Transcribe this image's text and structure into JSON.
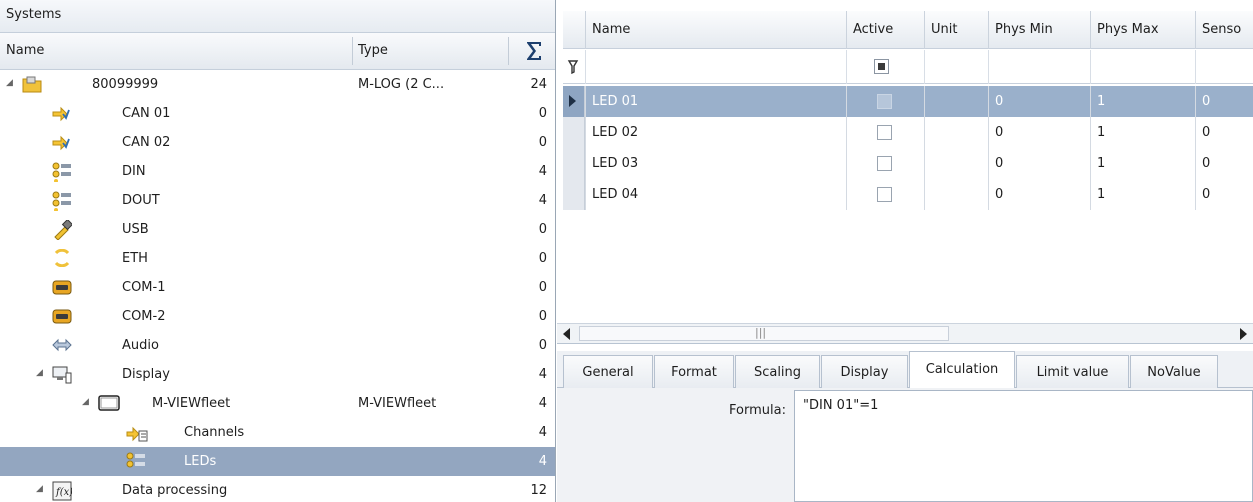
{
  "systems_panel": {
    "title": "Systems",
    "columns": {
      "name": "Name",
      "type": "Type",
      "sum_icon": "sigma-icon"
    },
    "tree": [
      {
        "label": "80099999",
        "type": "M-LOG (2 C...",
        "count": "24",
        "level": 0,
        "icon": "folder-device-icon"
      },
      {
        "label": "CAN 01",
        "type": "",
        "count": "0",
        "level": 1,
        "icon": "can-icon"
      },
      {
        "label": "CAN 02",
        "type": "",
        "count": "0",
        "level": 1,
        "icon": "can-icon"
      },
      {
        "label": "DIN",
        "type": "",
        "count": "4",
        "level": 1,
        "icon": "digital-io-icon"
      },
      {
        "label": "DOUT",
        "type": "",
        "count": "4",
        "level": 1,
        "icon": "digital-io-icon"
      },
      {
        "label": "USB",
        "type": "",
        "count": "0",
        "level": 1,
        "icon": "usb-icon"
      },
      {
        "label": "ETH",
        "type": "",
        "count": "0",
        "level": 1,
        "icon": "ethernet-icon"
      },
      {
        "label": "COM-1",
        "type": "",
        "count": "0",
        "level": 1,
        "icon": "serial-port-icon"
      },
      {
        "label": "COM-2",
        "type": "",
        "count": "0",
        "level": 1,
        "icon": "serial-port-icon"
      },
      {
        "label": "Audio",
        "type": "",
        "count": "0",
        "level": 1,
        "icon": "audio-icon"
      },
      {
        "label": "Display",
        "type": "",
        "count": "4",
        "level": 1,
        "icon": "display-icon"
      },
      {
        "label": "M-VIEWfleet",
        "type": "M-VIEWfleet",
        "count": "4",
        "level": 2,
        "icon": "monitor-icon"
      },
      {
        "label": "Channels",
        "type": "",
        "count": "4",
        "level": 3,
        "icon": "channels-icon"
      },
      {
        "label": "LEDs",
        "type": "",
        "count": "4",
        "level": 3,
        "icon": "leds-icon",
        "selected": true
      },
      {
        "label": "Data processing",
        "type": "",
        "count": "12",
        "level": 1,
        "icon": "function-icon"
      }
    ]
  },
  "grid": {
    "columns": [
      "Name",
      "Active",
      "Unit",
      "Phys Min",
      "Phys Max",
      "Senso"
    ],
    "rows": [
      {
        "name": "LED 01",
        "active": false,
        "unit": "",
        "phys_min": "0",
        "phys_max": "1",
        "sensor": "0",
        "selected": true
      },
      {
        "name": "LED 02",
        "active": false,
        "unit": "",
        "phys_min": "0",
        "phys_max": "1",
        "sensor": "0"
      },
      {
        "name": "LED 03",
        "active": false,
        "unit": "",
        "phys_min": "0",
        "phys_max": "1",
        "sensor": "0"
      },
      {
        "name": "LED 04",
        "active": false,
        "unit": "",
        "phys_min": "0",
        "phys_max": "1",
        "sensor": "0"
      }
    ],
    "filter_icon": "filter-icon",
    "scroll_grip": "|||"
  },
  "tabs": [
    {
      "label": "General"
    },
    {
      "label": "Format"
    },
    {
      "label": "Scaling"
    },
    {
      "label": "Display"
    },
    {
      "label": "Calculation",
      "active": true
    },
    {
      "label": "Limit value"
    },
    {
      "label": "NoValue"
    }
  ],
  "calculation": {
    "formula_label": "Formula:",
    "formula_value": "\"DIN 01\"=1"
  },
  "colors": {
    "selection": "#93a6c0",
    "grid_selection": "#9ab0cb",
    "header_bg": "#e6ebf1"
  }
}
